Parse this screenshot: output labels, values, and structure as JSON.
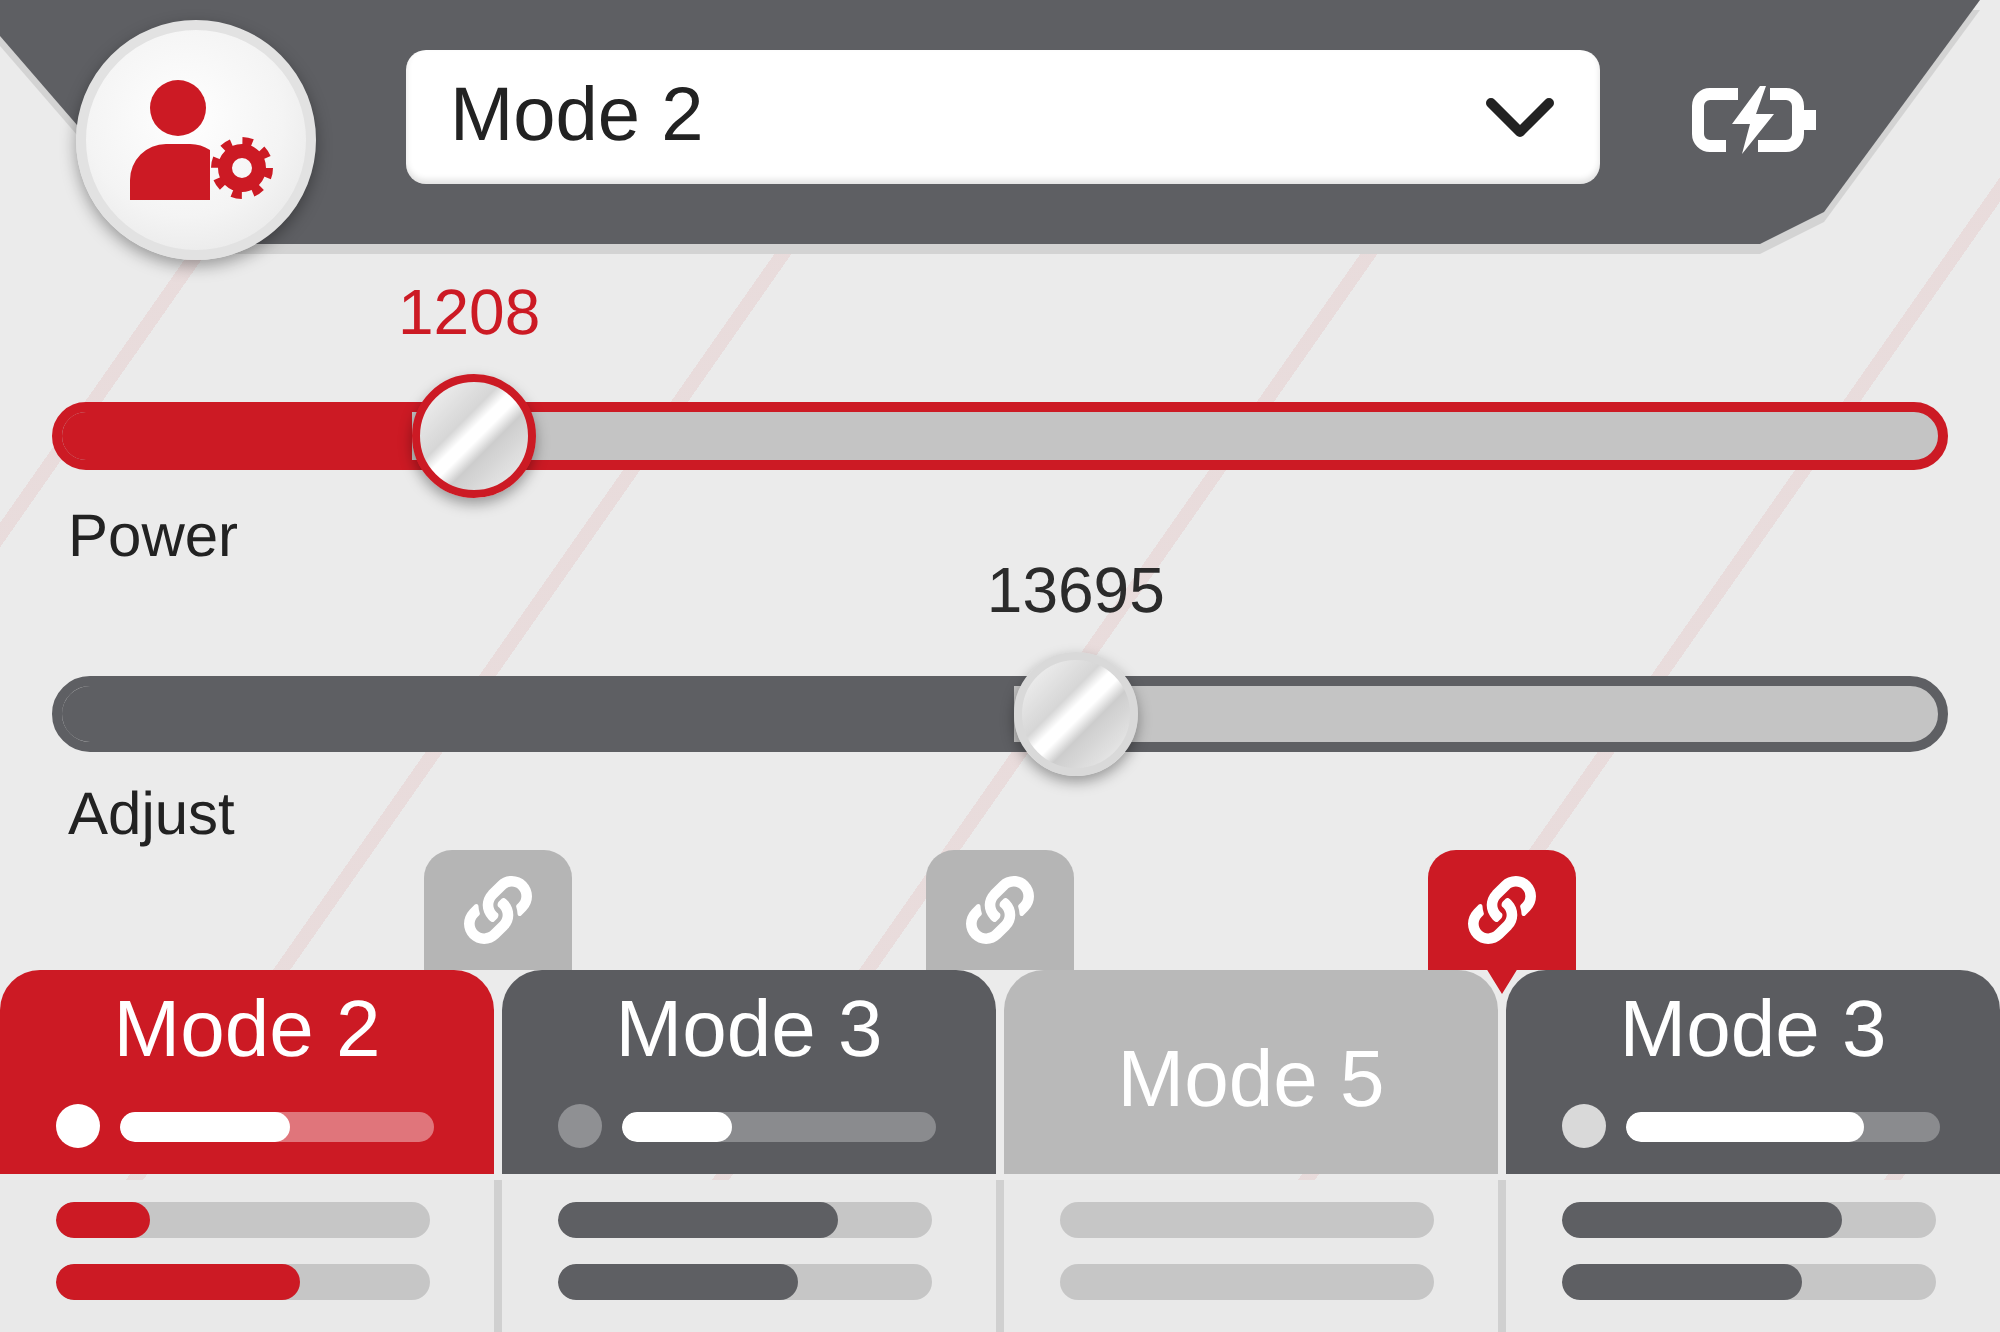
{
  "mode_select": {
    "value": "Mode 2"
  },
  "sliders": [
    {
      "kind": "primary",
      "reading": "1208",
      "level": 0.22,
      "label": "Power"
    },
    {
      "kind": "secondary",
      "reading": "13695",
      "level": 0.54,
      "label": "Adjust"
    }
  ],
  "links": [
    {
      "active": false
    },
    {
      "active": false
    },
    {
      "active": true
    }
  ],
  "tabs": [
    {
      "label": "Mode 2",
      "selected": true,
      "disabled": false,
      "indicator": {
        "color": "#ffffff",
        "level": 0.54
      },
      "meters": [
        {
          "level": 0.25
        },
        {
          "level": 0.65
        }
      ]
    },
    {
      "label": "Mode 3",
      "selected": false,
      "disabled": false,
      "indicator": {
        "color": "#8f9093",
        "level": 0.35
      },
      "meters": [
        {
          "level": 0.75
        },
        {
          "level": 0.64
        }
      ]
    },
    {
      "label": "Mode 5",
      "selected": false,
      "disabled": true
    },
    {
      "label": "Mode 3",
      "selected": false,
      "disabled": false,
      "indicator": {
        "color": "#d9d9d9",
        "level": 0.76
      },
      "meters": [
        {
          "level": 0.75
        },
        {
          "level": 0.64
        }
      ]
    }
  ]
}
